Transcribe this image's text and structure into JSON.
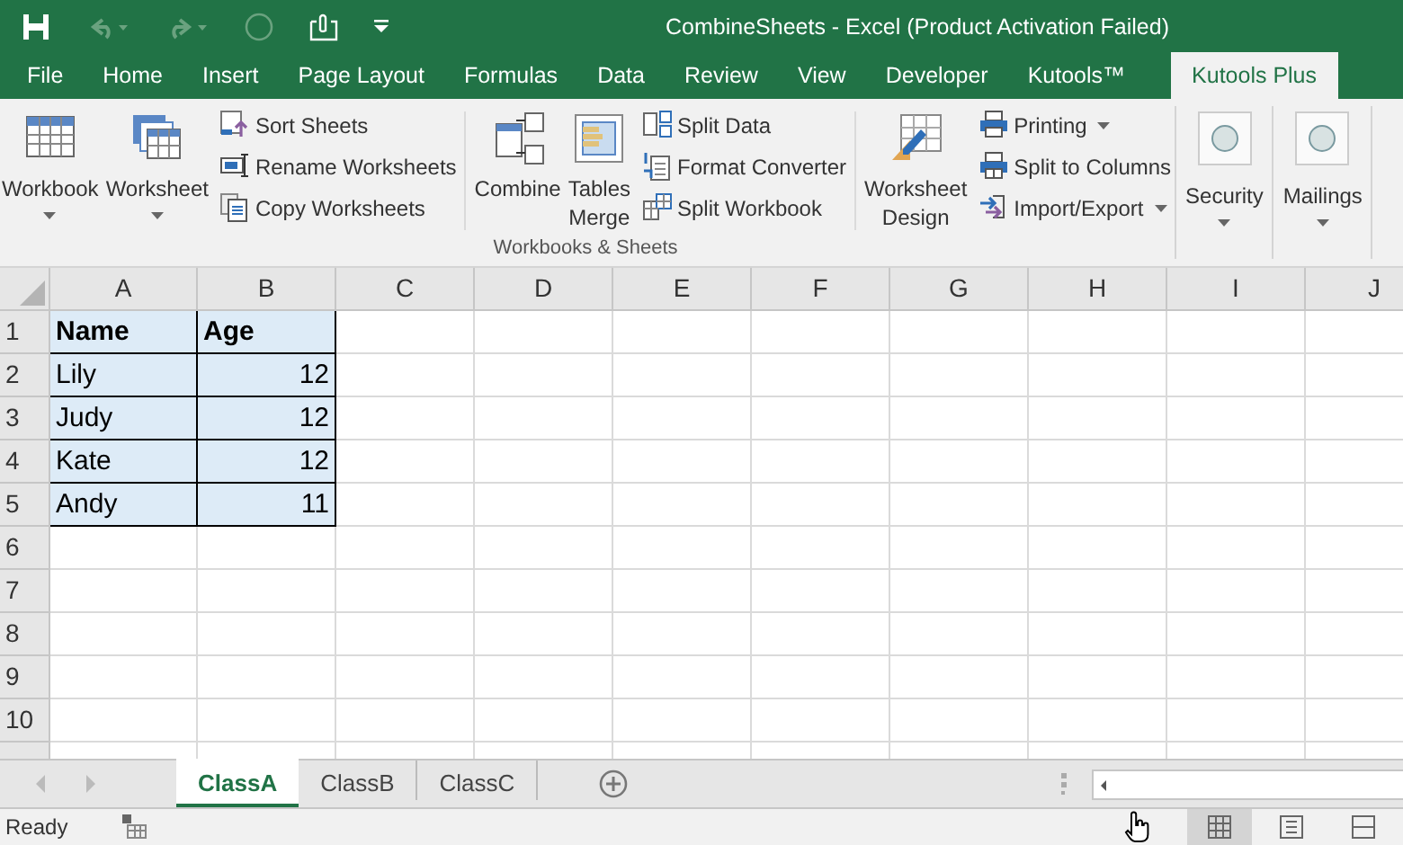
{
  "window": {
    "title": "CombineSheets - Excel (Product Activation Failed)"
  },
  "ribbon_tabs": [
    {
      "label": "File",
      "selected": false
    },
    {
      "label": "Home",
      "selected": false
    },
    {
      "label": "Insert",
      "selected": false
    },
    {
      "label": "Page Layout",
      "selected": false
    },
    {
      "label": "Formulas",
      "selected": false
    },
    {
      "label": "Data",
      "selected": false
    },
    {
      "label": "Review",
      "selected": false
    },
    {
      "label": "View",
      "selected": false
    },
    {
      "label": "Developer",
      "selected": false
    },
    {
      "label": "Kutools™",
      "selected": false
    },
    {
      "label": "Kutools Plus",
      "selected": true
    }
  ],
  "ribbon": {
    "groups": [
      {
        "label": "Workbooks & Sheets",
        "sections": [
          [
            {
              "kind": "large",
              "label": "Workbook",
              "dropdown": true
            },
            {
              "kind": "large",
              "label": "Worksheet",
              "dropdown": true
            },
            {
              "kind": "stack",
              "items": [
                {
                  "label": "Sort Sheets",
                  "dropdown": false
                },
                {
                  "label": "Rename Worksheets",
                  "dropdown": false
                },
                {
                  "label": "Copy Worksheets",
                  "dropdown": false
                }
              ]
            }
          ],
          [
            {
              "kind": "large",
              "label": "Combine",
              "dropdown": false
            },
            {
              "kind": "large",
              "label": "Tables\nMerge",
              "dropdown": false
            },
            {
              "kind": "stack",
              "items": [
                {
                  "label": "Split Data",
                  "dropdown": false
                },
                {
                  "label": "Format Converter",
                  "dropdown": false
                },
                {
                  "label": "Split Workbook",
                  "dropdown": false
                }
              ]
            }
          ],
          [
            {
              "kind": "large",
              "label": "Worksheet\nDesign",
              "dropdown": false
            },
            {
              "kind": "stack",
              "items": [
                {
                  "label": "Printing",
                  "dropdown": true
                },
                {
                  "label": "Split to Columns",
                  "dropdown": false
                },
                {
                  "label": "Import/Export",
                  "dropdown": true
                }
              ]
            }
          ]
        ]
      },
      {
        "sections": [
          [
            {
              "kind": "round",
              "label": "Security",
              "dropdown": true
            }
          ]
        ]
      },
      {
        "sections": [
          [
            {
              "kind": "round",
              "label": "Mailings",
              "dropdown": true
            }
          ]
        ]
      }
    ]
  },
  "table": {
    "columns": [
      "A",
      "B",
      "C",
      "D",
      "E",
      "F",
      "G",
      "H",
      "I",
      "J"
    ],
    "rows": [
      {
        "header": "1",
        "cells": [
          {
            "text": "Name",
            "kind": "heading",
            "selected": true
          },
          {
            "text": "Age",
            "kind": "heading",
            "selected": true
          }
        ]
      },
      {
        "header": "2",
        "cells": [
          {
            "text": "Lily",
            "kind": "text",
            "selected": true
          },
          {
            "text": "12",
            "kind": "number",
            "selected": true
          }
        ]
      },
      {
        "header": "3",
        "cells": [
          {
            "text": "Judy",
            "kind": "text",
            "selected": true
          },
          {
            "text": "12",
            "kind": "number",
            "selected": true
          }
        ]
      },
      {
        "header": "4",
        "cells": [
          {
            "text": "Kate",
            "kind": "text",
            "selected": true
          },
          {
            "text": "12",
            "kind": "number",
            "selected": true
          }
        ]
      },
      {
        "header": "5",
        "cells": [
          {
            "text": "Andy",
            "kind": "text",
            "selected": true
          },
          {
            "text": "11",
            "kind": "number",
            "selected": true
          }
        ]
      },
      {
        "header": "6",
        "cells": []
      },
      {
        "header": "7",
        "cells": []
      },
      {
        "header": "8",
        "cells": []
      },
      {
        "header": "9",
        "cells": []
      },
      {
        "header": "10",
        "cells": []
      }
    ]
  },
  "sheet_tabs": [
    {
      "label": "ClassA",
      "selected": true
    },
    {
      "label": "ClassB",
      "selected": false
    },
    {
      "label": "ClassC",
      "selected": false
    }
  ],
  "status_bar": {
    "text": "Ready"
  },
  "view_buttons": [
    {
      "selected": true
    },
    {
      "selected": false
    },
    {
      "selected": false
    }
  ]
}
